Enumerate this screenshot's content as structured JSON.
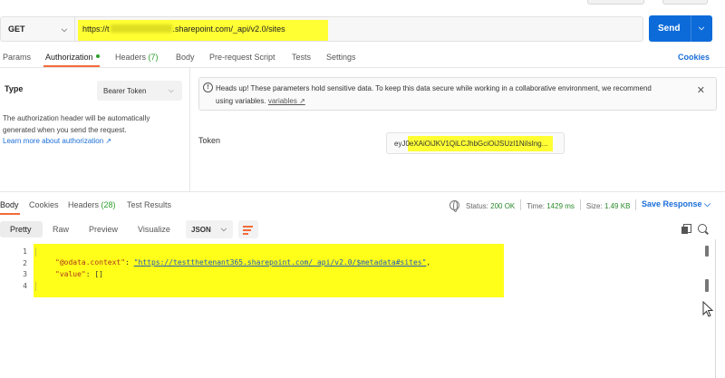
{
  "request": {
    "method": "GET",
    "url_prefix": "https://t",
    "url_suffix": ".sharepoint.com/_api/v2.0/sites",
    "send_label": "Send"
  },
  "request_tabs": {
    "params": "Params",
    "authorization": "Authorization",
    "headers": "Headers",
    "headers_count": "(7)",
    "body": "Body",
    "prerequest": "Pre-request Script",
    "tests": "Tests",
    "settings": "Settings",
    "cookies": "Cookies"
  },
  "auth": {
    "type_label": "Type",
    "type_value": "Bearer Token",
    "help_text": "The authorization header will be automatically generated when you send the request.",
    "learn_more": "Learn more about authorization ↗",
    "notice_text": "Heads up! These parameters hold sensitive data. To keep this data secure while working in a collaborative environment, we recommend using variables.",
    "notice_link": "variables ↗",
    "token_label": "Token",
    "token_value": "eyJ0eXAiOiJKV1QiLCJhbGciOiJSUzI1NiIsIng..."
  },
  "response_tabs": {
    "body": "Body",
    "cookies": "Cookies",
    "headers": "Headers",
    "headers_count": "(28)",
    "test_results": "Test Results"
  },
  "response_status": {
    "status_label": "Status:",
    "status_value": "200 OK",
    "time_label": "Time:",
    "time_value": "1429 ms",
    "size_label": "Size:",
    "size_value": "1.49 KB",
    "save_response": "Save Response"
  },
  "view_modes": {
    "pretty": "Pretty",
    "raw": "Raw",
    "preview": "Preview",
    "visualize": "Visualize",
    "format": "JSON"
  },
  "code": {
    "line_numbers": [
      "1",
      "2",
      "3",
      "4"
    ],
    "key_context": "\"@odata.context\"",
    "value_context": "\"https://testthetenant365.sharepoint.com/_api/v2.0/$metadata#sites\"",
    "key_value": "\"value\"",
    "value_value": "[]"
  },
  "colors": {
    "accent": "#f26b3a",
    "send_button": "#0d6bd9",
    "link": "#1a6ed8",
    "highlight": "#ffff33",
    "status_ok": "#2a8a2a"
  }
}
